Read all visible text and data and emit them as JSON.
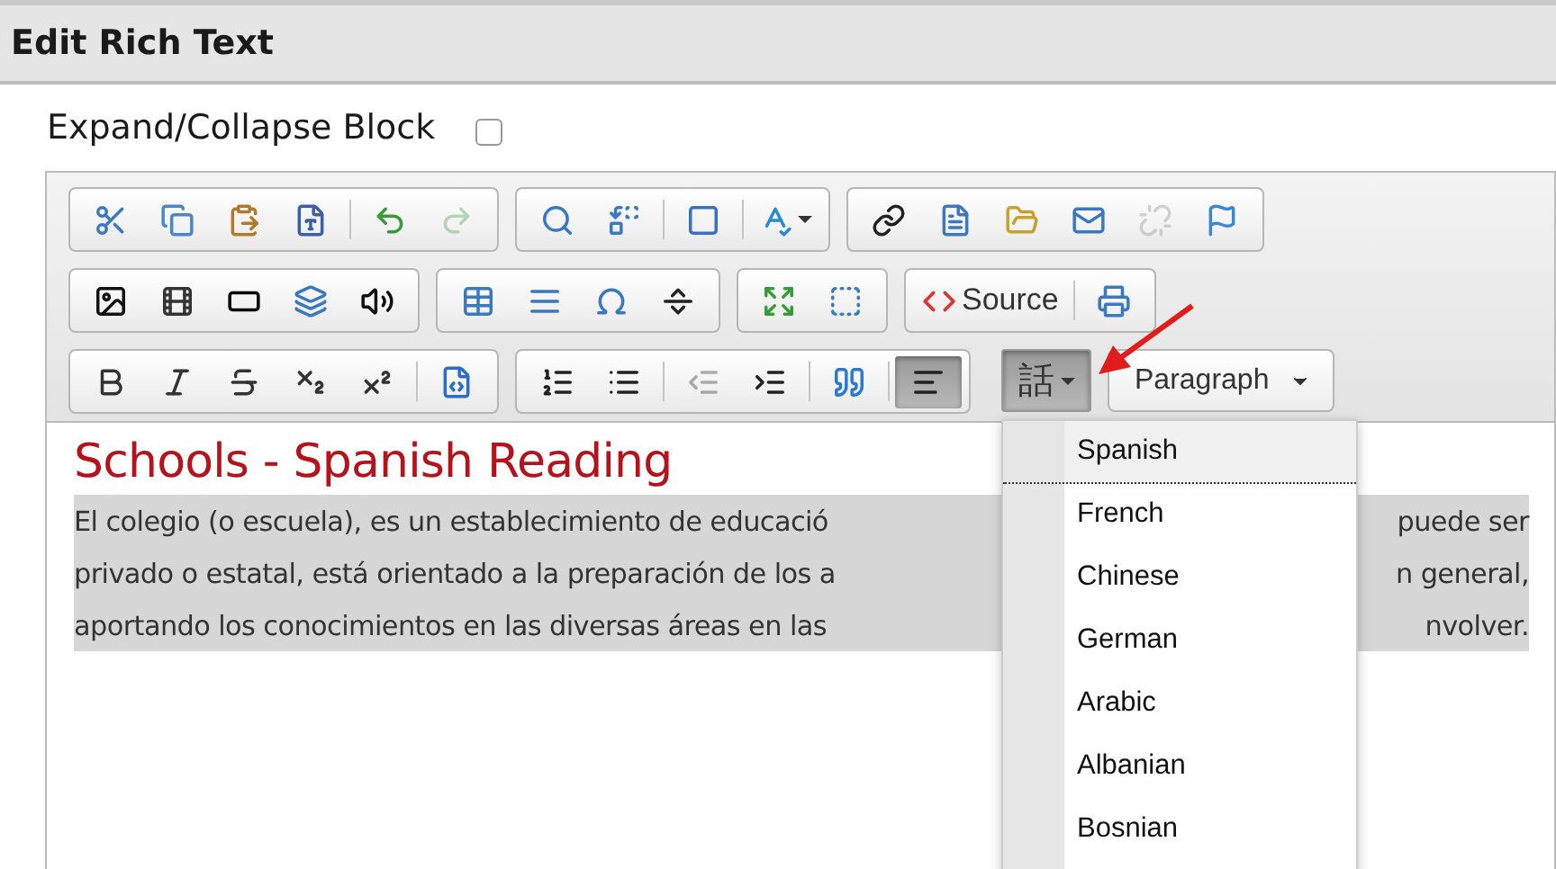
{
  "panel": {
    "title": "Edit Rich Text"
  },
  "expand_collapse": {
    "label": "Expand/Collapse Block",
    "checked": false
  },
  "toolbar": {
    "rows": [
      [
        [
          {
            "kind": "button",
            "disabled": false
          },
          {
            "kind": "button",
            "disabled": false
          },
          {
            "kind": "button",
            "disabled": false
          },
          {
            "kind": "button",
            "disabled": false
          },
          {
            "kind": "separator"
          },
          {
            "kind": "button",
            "disabled": false
          },
          {
            "kind": "button",
            "disabled": true
          }
        ],
        [
          {
            "kind": "button",
            "disabled": false
          },
          {
            "kind": "button",
            "disabled": false
          },
          {
            "kind": "separator"
          },
          {
            "kind": "button",
            "disabled": false
          },
          {
            "kind": "separator"
          },
          {
            "kind": "menu",
            "disabled": false
          }
        ],
        [
          {
            "kind": "button",
            "disabled": false
          },
          {
            "kind": "button",
            "disabled": false
          },
          {
            "kind": "button",
            "disabled": false
          },
          {
            "kind": "button",
            "disabled": false
          },
          {
            "kind": "button",
            "disabled": true
          },
          {
            "kind": "button",
            "disabled": false
          }
        ]
      ],
      [
        [
          {
            "kind": "button",
            "disabled": false
          },
          {
            "kind": "button",
            "disabled": false
          },
          {
            "kind": "button",
            "disabled": false
          },
          {
            "kind": "button",
            "disabled": false
          },
          {
            "kind": "button",
            "disabled": false
          }
        ],
        [
          {
            "kind": "button",
            "disabled": false
          },
          {
            "kind": "button",
            "disabled": false
          },
          {
            "kind": "button",
            "disabled": false
          },
          {
            "kind": "button",
            "disabled": false
          }
        ],
        [
          {
            "kind": "button",
            "disabled": false
          },
          {
            "kind": "button",
            "disabled": false
          }
        ],
        [
          {
            "kind": "labeled",
            "label": "Source",
            "disabled": false
          },
          {
            "kind": "separator"
          },
          {
            "kind": "button",
            "disabled": false
          }
        ]
      ],
      [
        [
          {
            "kind": "button",
            "disabled": false
          },
          {
            "kind": "button",
            "disabled": false
          },
          {
            "kind": "button",
            "disabled": false
          },
          {
            "kind": "button",
            "disabled": false
          },
          {
            "kind": "button",
            "disabled": false
          },
          {
            "kind": "separator"
          },
          {
            "kind": "button",
            "disabled": false
          }
        ],
        [
          {
            "kind": "button",
            "disabled": false,
            "pressed": false
          },
          {
            "kind": "button",
            "disabled": false,
            "pressed": false
          },
          {
            "kind": "separator"
          },
          {
            "kind": "button",
            "disabled": true,
            "pressed": false
          },
          {
            "kind": "button",
            "disabled": false,
            "pressed": false
          },
          {
            "kind": "separator"
          },
          {
            "kind": "button",
            "disabled": false,
            "pressed": false
          },
          {
            "kind": "separator"
          },
          {
            "kind": "button",
            "disabled": false,
            "pressed": true
          }
        ]
      ]
    ]
  },
  "language_button": {
    "label": "話",
    "pressed": true
  },
  "format_combo": {
    "value": "Paragraph"
  },
  "content": {
    "heading": "Schools - Spanish Reading",
    "selected": true,
    "lines": [
      {
        "left": "El colegio (o escuela), es un establecimiento de educació",
        "right": "puede ser"
      },
      {
        "left": "privado o estatal, está orientado a la preparación de los a",
        "right": "n general,"
      },
      {
        "left": "aportando los conocimientos en las diversas áreas en las",
        "right": "nvolver."
      }
    ]
  },
  "language_menu": {
    "items": [
      {
        "label": "Spanish",
        "selected": true
      },
      {
        "label": "French",
        "selected": false
      },
      {
        "label": "Chinese",
        "selected": false
      },
      {
        "label": "German",
        "selected": false
      },
      {
        "label": "Arabic",
        "selected": false
      },
      {
        "label": "Albanian",
        "selected": false
      },
      {
        "label": "Bosnian",
        "selected": false
      }
    ]
  }
}
